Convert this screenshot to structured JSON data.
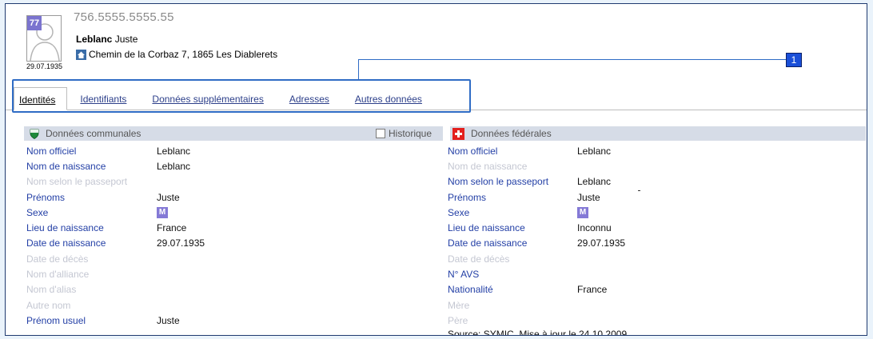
{
  "header": {
    "age": "77",
    "avs_number": "756.5555.5555.55",
    "birth_date_short": "29.07.1935",
    "last_name": "Leblanc",
    "first_name": "Juste",
    "address": "Chemin de la Corbaz 7, 1865 Les Diablerets"
  },
  "callout": {
    "number": "1"
  },
  "tabs": [
    {
      "label": "Identités",
      "active": true
    },
    {
      "label": "Identifiants"
    },
    {
      "label": "Données supplémentaires"
    },
    {
      "label": "Adresses"
    },
    {
      "label": "Autres données"
    }
  ],
  "left_panel": {
    "title": "Données communales",
    "historique_label": "Historique",
    "rows": [
      {
        "label": "Nom officiel",
        "value": "Leblanc"
      },
      {
        "label": "Nom de naissance",
        "value": "Leblanc"
      },
      {
        "label": "Nom selon le passeport",
        "value": "",
        "dim": true
      },
      {
        "label": "Prénoms",
        "value": "Juste"
      },
      {
        "label": "Sexe",
        "badge": "M"
      },
      {
        "label": "Lieu de naissance",
        "value": "France"
      },
      {
        "label": "Date de naissance",
        "value": "29.07.1935"
      },
      {
        "label": "Date de décès",
        "value": "",
        "dim": true
      },
      {
        "label": "Nom d'alliance",
        "value": "",
        "dim": true
      },
      {
        "label": "Nom d'alias",
        "value": "",
        "dim": true
      },
      {
        "label": "Autre nom",
        "value": "",
        "dim": true
      },
      {
        "label": "Prénom usuel",
        "value": "Juste"
      }
    ]
  },
  "right_panel": {
    "title": "Données fédérales",
    "rows": [
      {
        "label": "Nom officiel",
        "value": "Leblanc"
      },
      {
        "label": "Nom de naissance",
        "value": "",
        "dim": true
      },
      {
        "label": "Nom selon le passeport",
        "value": "Leblanc"
      },
      {
        "label": "Prénoms",
        "value": "Juste"
      },
      {
        "label": "Sexe",
        "badge": "M"
      },
      {
        "label": "Lieu de naissance",
        "value": "Inconnu"
      },
      {
        "label": "Date de naissance",
        "value": "29.07.1935"
      },
      {
        "label": "Date de décès",
        "value": "",
        "dim": true
      },
      {
        "label": "N° AVS",
        "value": ""
      },
      {
        "label": "Nationalité",
        "value": "France"
      },
      {
        "label": "Mère",
        "value": "",
        "dim": true
      },
      {
        "label": "Père",
        "value": "",
        "dim": true
      }
    ],
    "source": "Source: SYMIC. Mise à jour le 24.10.2009"
  },
  "colors": {
    "label_blue": "#2440a6",
    "dim_label": "#c4c7d2",
    "panel_header": "#d6dce7",
    "badge_purple": "#8479d6",
    "highlight_blue": "#2f6cc5"
  }
}
